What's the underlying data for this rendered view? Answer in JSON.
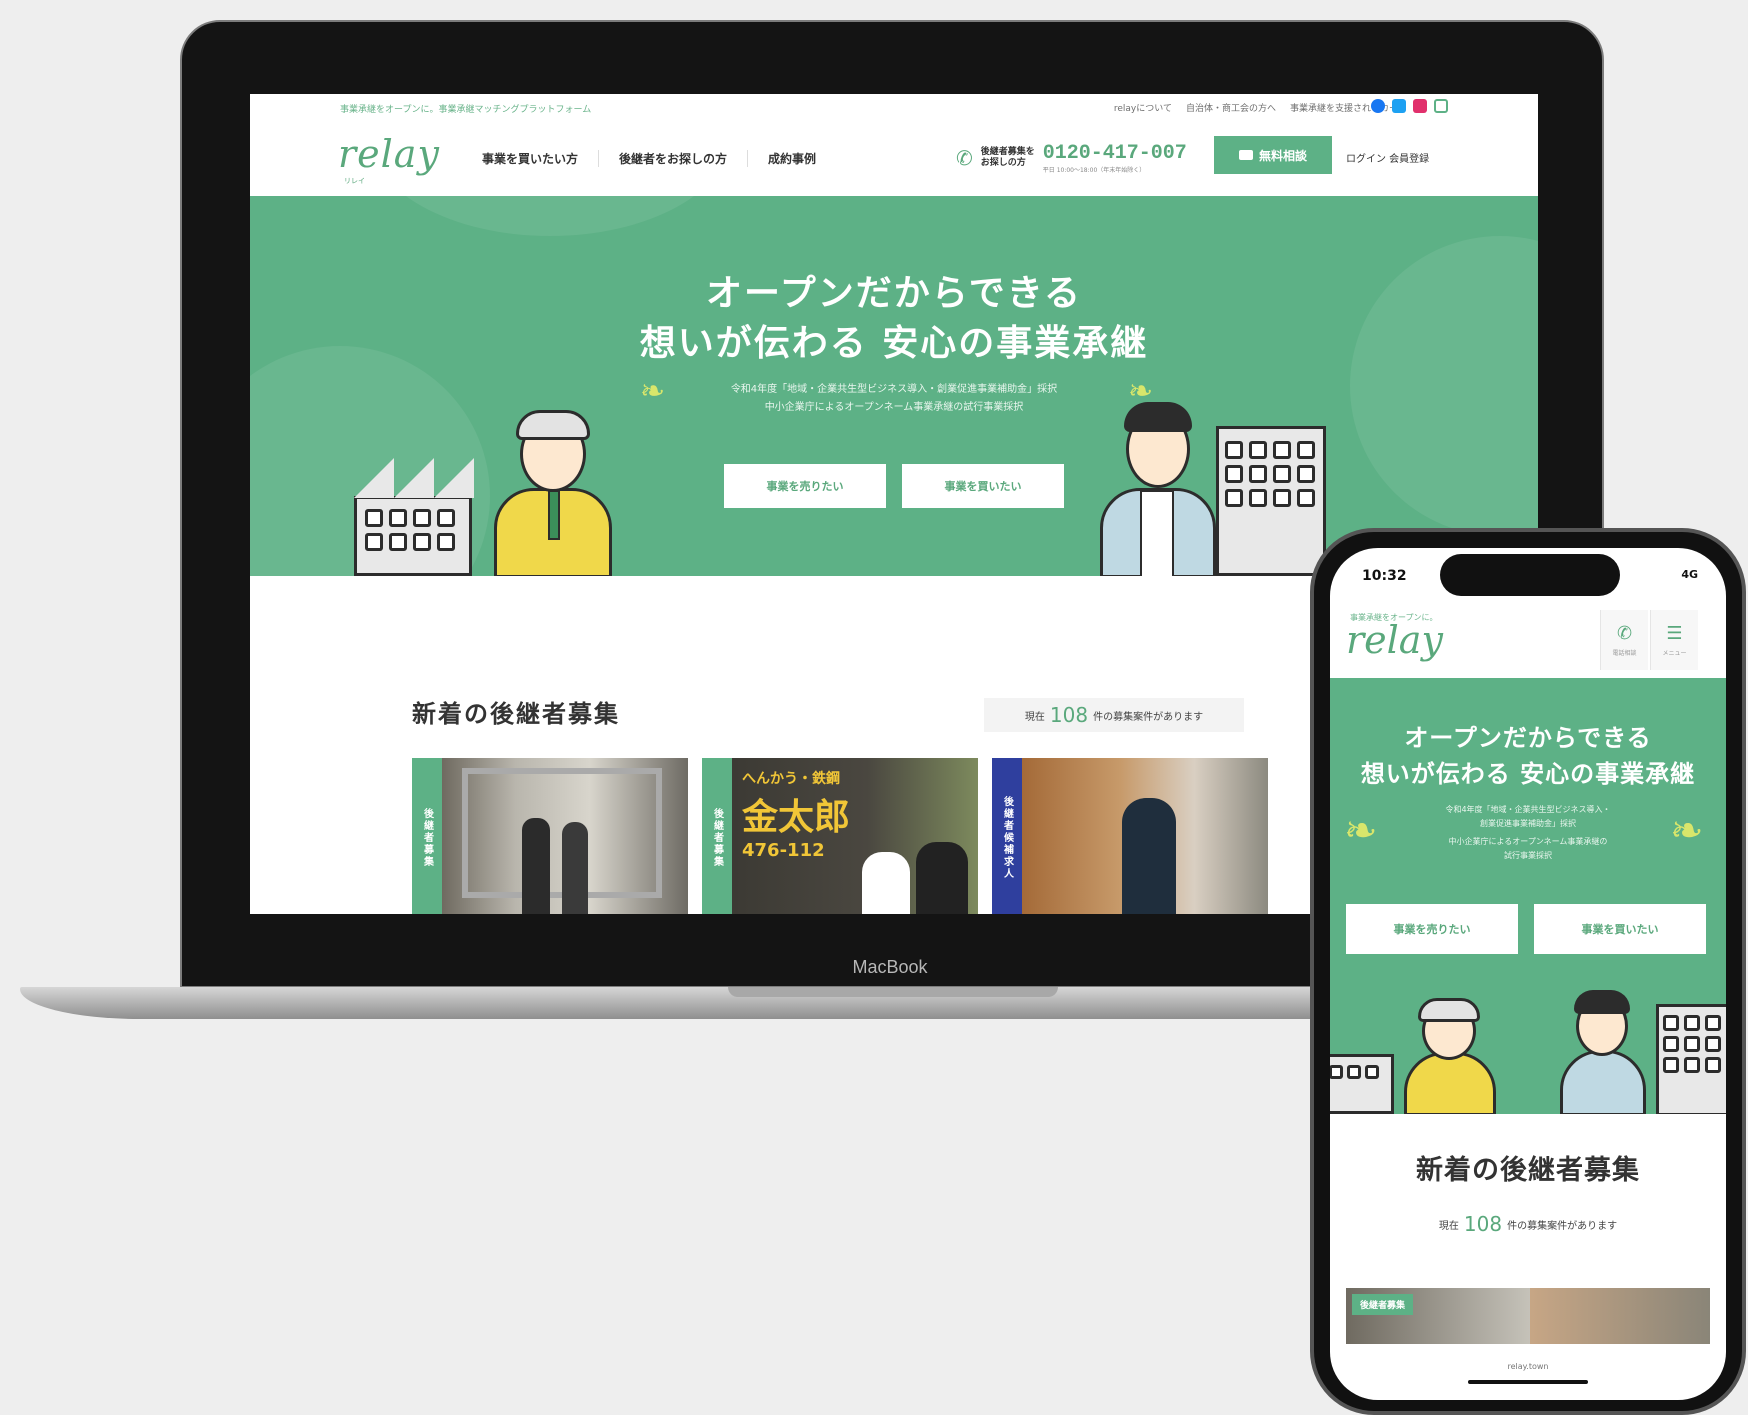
{
  "laptop": {
    "brand_label": "MacBook",
    "topbar": {
      "tagline": "事業承継をオープンに。事業承継マッチングプラットフォーム",
      "links": [
        "relayについて",
        "自治体・商工会の方へ",
        "事業承継を支援されるカー"
      ],
      "social_icons": [
        "facebook-icon",
        "twitter-icon",
        "instagram-icon",
        "note-icon"
      ]
    },
    "header": {
      "logo": "relay",
      "logo_sub": "リレイ",
      "nav": [
        "事業を買いたい方",
        "後継者をお探しの方",
        "成約事例"
      ],
      "phone_label_1": "後継者募集を",
      "phone_label_2": "お探しの方",
      "phone_number": "0120-417-007",
      "phone_hours": "平日 10:00〜18:00（年末年始除く）",
      "consult_button": "無料相談",
      "login_label": "ログイン 会員登録"
    },
    "hero": {
      "title_line1": "オープンだからできる",
      "title_line2": "想いが伝わる 安心の事業承継",
      "sub_line1": "令和4年度「地域・企業共生型ビジネス導入・創業促進事業補助金」採択",
      "sub_line2": "中小企業庁によるオープンネーム事業承継の試行事業採択",
      "button_sell": "事業を売りたい",
      "button_buy": "事業を買いたい"
    },
    "listing": {
      "title": "新着の後継者募集",
      "count_prefix": "現在",
      "count": "108",
      "count_suffix": "件の募集案件があります",
      "cards": [
        {
          "tag": "後継者募集",
          "tag_color": "#5db186"
        },
        {
          "tag": "後継者募集",
          "tag_color": "#5db186"
        },
        {
          "tag": "後継者候補求人",
          "tag_color": "#2f3f9e"
        }
      ],
      "card2_sign_line1": "へんかう・鉄鋼",
      "card2_sign_line2": "金太郎",
      "card2_sign_line3": "476-112"
    }
  },
  "phone": {
    "time": "10:32",
    "signal": "4G",
    "tagline": "事業承継をオープンに。",
    "logo": "relay",
    "tel_label": "電話相談",
    "menu_label": "メニュー",
    "hero": {
      "title_line1": "オープンだからできる",
      "title_line2": "想いが伝わる 安心の事業承継",
      "sub_line1": "令和4年度「地域・企業共生型ビジネス導入・",
      "sub_line2": "創業促進事業補助金」採択",
      "sub_line3": "中小企業庁によるオープンネーム事業承継の",
      "sub_line4": "試行事業採択",
      "button_sell": "事業を売りたい",
      "button_buy": "事業を買いたい"
    },
    "listing_title": "新着の後継者募集",
    "count_prefix": "現在",
    "count": "108",
    "count_suffix": "件の募集案件があります",
    "card_tag": "後継者募集",
    "url": "relay.town"
  },
  "colors": {
    "brand_green": "#5db186",
    "accent_yellow": "#d9e66b",
    "recruit_blue": "#2f3f9e"
  }
}
